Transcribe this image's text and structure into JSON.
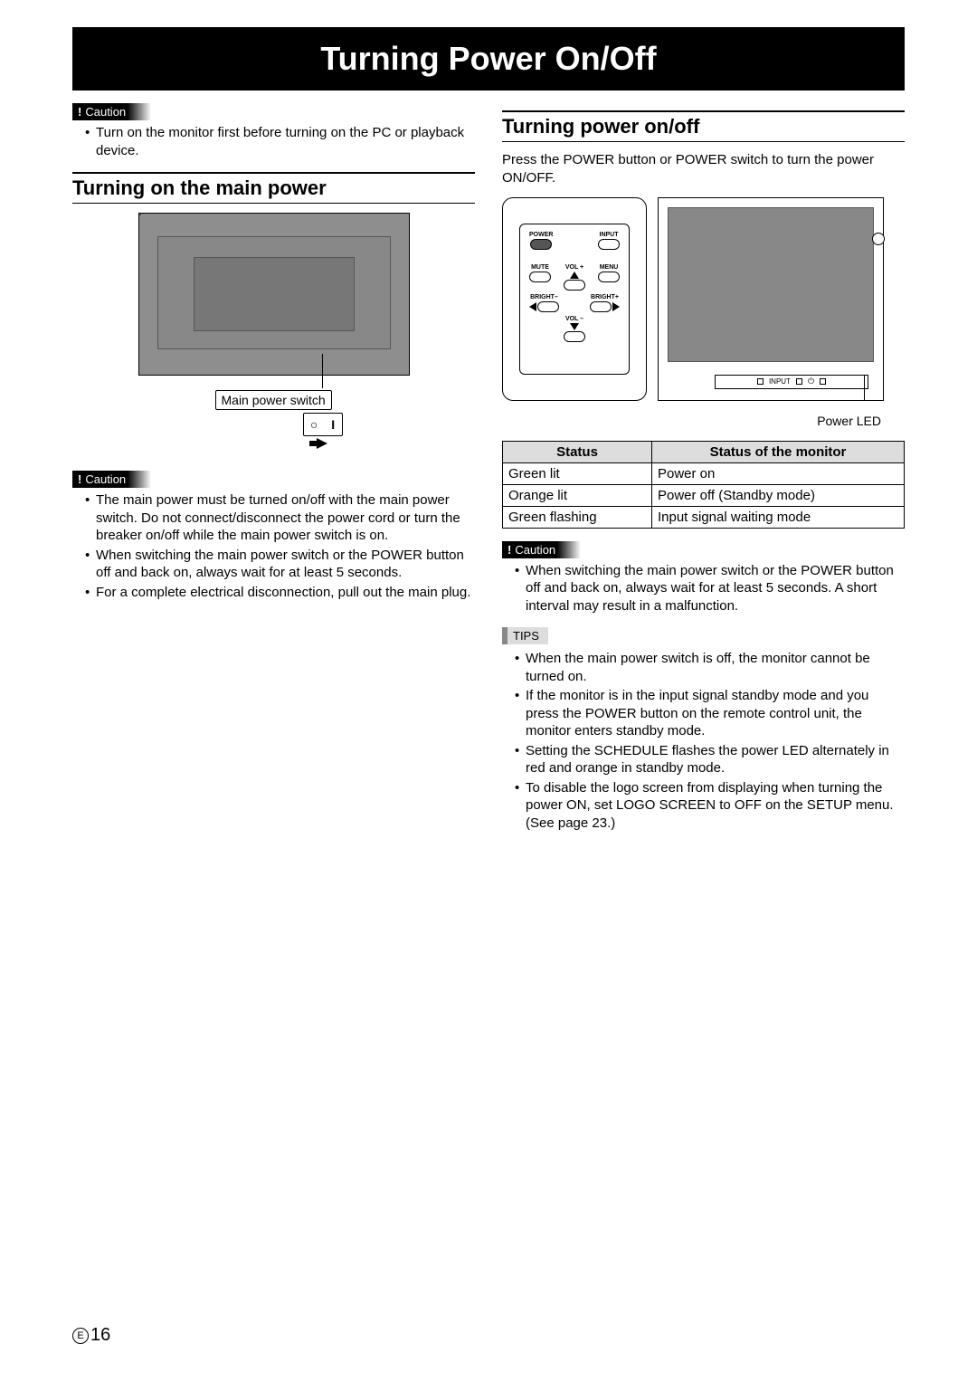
{
  "title": "Turning Power On/Off",
  "left": {
    "caution1": {
      "label": "Caution",
      "items": [
        "Turn on the monitor first before turning on the PC or playback device."
      ]
    },
    "heading": "Turning on the main power",
    "switch_label": "Main power switch",
    "caution2": {
      "label": "Caution",
      "items": [
        "The main power must be turned on/off with the main power switch. Do not connect/disconnect the power cord or turn the breaker on/off while the main power switch is on.",
        "When switching the main power switch or the POWER button off and back on, always wait for at least 5 seconds.",
        "For a complete electrical disconnection, pull out the main plug."
      ]
    }
  },
  "right": {
    "heading": "Turning power on/off",
    "intro": "Press the POWER button or POWER switch to turn the power ON/OFF.",
    "remote_labels": {
      "power": "POWER",
      "input": "INPUT",
      "mute": "MUTE",
      "menu": "MENU",
      "volp": "VOL +",
      "volm": "VOL –",
      "brightm": "BRIGHT–",
      "brightp": "BRIGHT+"
    },
    "monitor_bar": {
      "input": "INPUT"
    },
    "power_led_label": "Power LED",
    "table": {
      "head": [
        "Status",
        "Status of the monitor"
      ],
      "rows": [
        [
          "Green lit",
          "Power on"
        ],
        [
          "Orange lit",
          "Power off (Standby mode)"
        ],
        [
          "Green flashing",
          "Input signal waiting mode"
        ]
      ]
    },
    "caution": {
      "label": "Caution",
      "items": [
        "When switching the main power switch or the POWER button off and back on, always wait for at least 5 seconds. A short interval may result in a malfunction."
      ]
    },
    "tips": {
      "label": "TIPS",
      "items": [
        "When the main power switch is off, the monitor cannot be turned on.",
        "If the monitor is in the input signal standby mode and you press the POWER button on the remote control unit, the monitor enters standby mode.",
        "Setting the SCHEDULE flashes the power LED alternately in red and orange in standby mode.",
        "To disable the logo screen from displaying when turning the power ON, set LOGO SCREEN to OFF on the SETUP menu. (See page 23.)"
      ]
    }
  },
  "page_marker": {
    "letter": "E",
    "number": "16"
  }
}
